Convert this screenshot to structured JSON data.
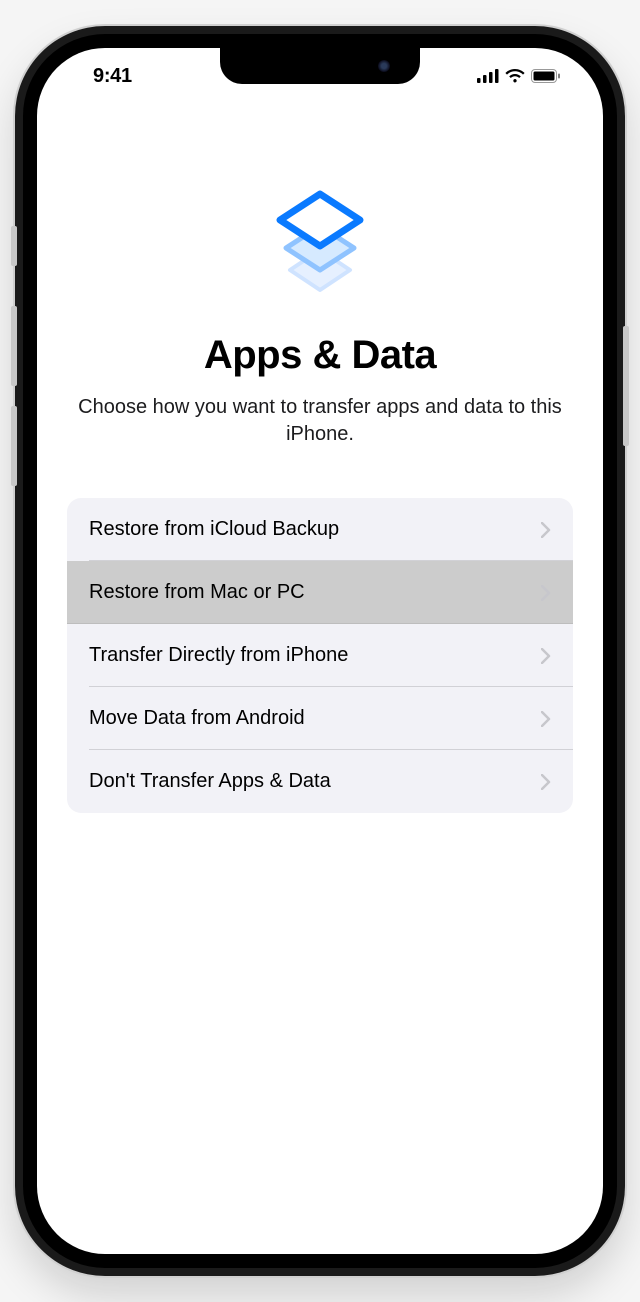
{
  "status": {
    "time": "9:41"
  },
  "page": {
    "title": "Apps & Data",
    "subtitle": "Choose how you want to transfer apps and data to this iPhone."
  },
  "options": {
    "items": [
      {
        "label": "Restore from iCloud Backup",
        "selected": false
      },
      {
        "label": "Restore from Mac or PC",
        "selected": true
      },
      {
        "label": "Transfer Directly from iPhone",
        "selected": false
      },
      {
        "label": "Move Data from Android",
        "selected": false
      },
      {
        "label": "Don't Transfer Apps & Data",
        "selected": false
      }
    ]
  }
}
